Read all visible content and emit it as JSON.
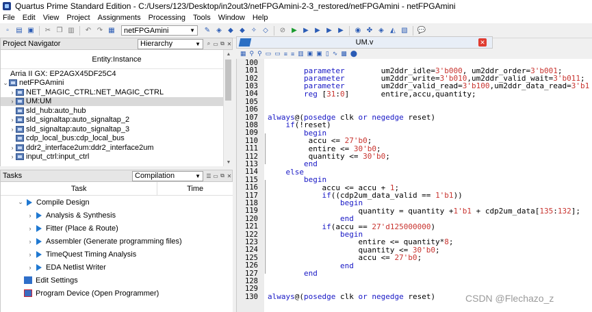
{
  "window": {
    "title": "Quartus Prime Standard Edition - C:/Users/123/Desktop/in2out3/netFPGAmini-2-3_restored/netFPGAmini - netFPGAmini"
  },
  "menu": [
    "File",
    "Edit",
    "View",
    "Project",
    "Assignments",
    "Processing",
    "Tools",
    "Window",
    "Help"
  ],
  "toolbar": {
    "project_select": "netFPGAmini"
  },
  "project_navigator": {
    "title": "Project Navigator",
    "view_select": "Hierarchy",
    "column_header": "Entity:Instance",
    "device": "Arria II GX: EP2AGX45DF25C4",
    "root": "netFPGAmini",
    "items": [
      "NET_MAGIC_CTRL:NET_MAGIC_CTRL",
      "UM:UM",
      "sld_hub:auto_hub",
      "sld_signaltap:auto_signaltap_2",
      "sld_signaltap:auto_signaltap_3",
      "cdp_local_bus:cdp_local_bus",
      "ddr2_interface2um:ddr2_interface2um",
      "input_ctrl:input_ctrl"
    ]
  },
  "tasks": {
    "title": "Tasks",
    "flow_select": "Compilation",
    "col_task": "Task",
    "col_time": "Time",
    "compile_design": "Compile Design",
    "steps": [
      "Analysis & Synthesis",
      "Fitter (Place & Route)",
      "Assembler (Generate programming files)",
      "TimeQuest Timing Analysis",
      "EDA Netlist Writer"
    ],
    "edit_settings": "Edit Settings",
    "program_device": "Program Device (Open Programmer)"
  },
  "editor": {
    "tab_name": "UM.v",
    "lines": [
      {
        "n": "100",
        "t": ""
      },
      {
        "n": "101",
        "t": "        parameter        um2ddr_idle=3'b000, um2ddr_order=3'b001;"
      },
      {
        "n": "102",
        "t": "        parameter        um2ddr_write=3'b010,um2ddr_valid_wait=3'b011;"
      },
      {
        "n": "103",
        "t": "        parameter        um2ddr_valid_read=3'b100,um2ddr_data_read=3'b1"
      },
      {
        "n": "104",
        "t": "        reg [31:0]       entire,accu,quantity;"
      },
      {
        "n": "105",
        "t": ""
      },
      {
        "n": "106",
        "t": ""
      },
      {
        "n": "107",
        "t": "always@(posedge clk or negedge reset)"
      },
      {
        "n": "108",
        "t": "    if(!reset)"
      },
      {
        "n": "109",
        "t": "        begin"
      },
      {
        "n": "110",
        "t": "         accu <= 27'b0;"
      },
      {
        "n": "111",
        "t": "         entire <= 30'b0;"
      },
      {
        "n": "112",
        "t": "         quantity <= 30'b0;"
      },
      {
        "n": "113",
        "t": "        end"
      },
      {
        "n": "114",
        "t": "    else"
      },
      {
        "n": "115",
        "t": "        begin"
      },
      {
        "n": "116",
        "t": "            accu <= accu + 1;"
      },
      {
        "n": "117",
        "t": "            if((cdp2um_data_valid == 1'b1))"
      },
      {
        "n": "118",
        "t": "                begin"
      },
      {
        "n": "119",
        "t": "                    quantity = quantity +1'b1 + cdp2um_data[135:132];"
      },
      {
        "n": "120",
        "t": "                end"
      },
      {
        "n": "121",
        "t": "            if(accu == 27'd125000000)"
      },
      {
        "n": "122",
        "t": "                begin"
      },
      {
        "n": "123",
        "t": "                    entire <= quantity*8;"
      },
      {
        "n": "124",
        "t": "                    quantity <= 30'b0;"
      },
      {
        "n": "125",
        "t": "                    accu <= 27'b0;"
      },
      {
        "n": "126",
        "t": "                end"
      },
      {
        "n": "127",
        "t": "        end"
      },
      {
        "n": "128",
        "t": ""
      },
      {
        "n": "129",
        "t": ""
      },
      {
        "n": "130",
        "t": "always@(posedge clk or negedge reset)"
      }
    ]
  },
  "watermark": "CSDN @Flechazo_z"
}
